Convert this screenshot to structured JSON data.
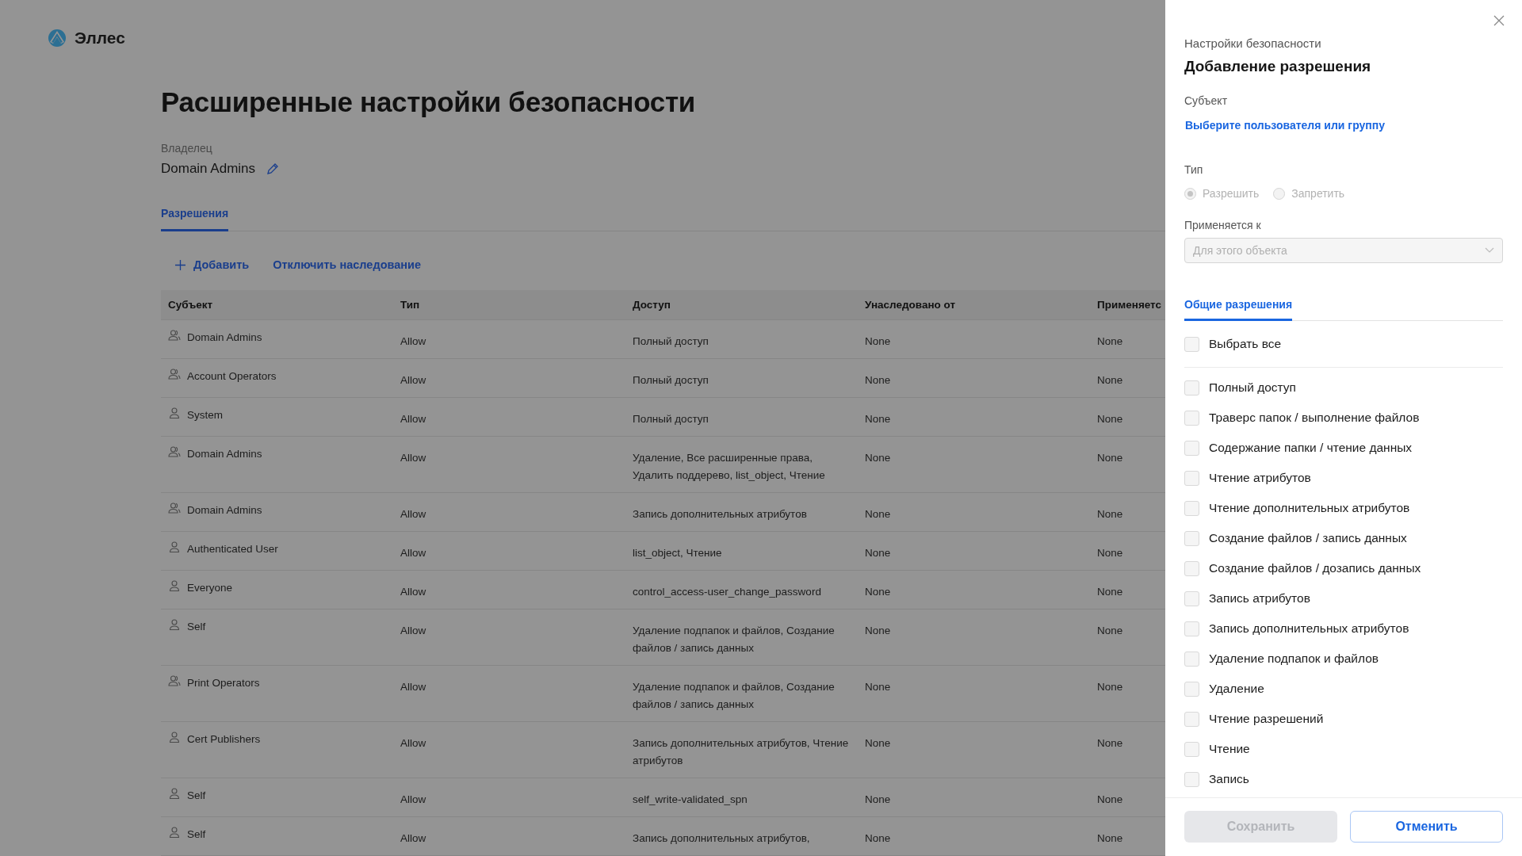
{
  "app": {
    "name": "Эллес"
  },
  "page": {
    "title": "Расширенные настройки безопасности",
    "owner_label": "Владелец",
    "owner": "Domain Admins",
    "tabs": [
      {
        "label": "Разрешения",
        "selected": true
      }
    ],
    "actions": [
      {
        "kind": "add",
        "label": "Добавить"
      },
      {
        "kind": "link",
        "label": "Отключить наследование"
      }
    ]
  },
  "table": {
    "columns": [
      "Субъект",
      "Тип",
      "Доступ",
      "Унаследовано от",
      "Применяетс"
    ],
    "rows": [
      {
        "kind": "group",
        "cells": [
          "Domain Admins",
          "Allow",
          "Полный доступ",
          "None",
          "None"
        ]
      },
      {
        "kind": "group",
        "cells": [
          "Account Operators",
          "Allow",
          "Полный доступ",
          "None",
          "None"
        ]
      },
      {
        "kind": "user",
        "cells": [
          "System",
          "Allow",
          "Полный доступ",
          "None",
          "None"
        ]
      },
      {
        "kind": "group",
        "cells": [
          "Domain Admins",
          "Allow",
          "Удаление, Все расширенные права, Удалить поддерево, list_object, Чтение",
          "None",
          "None"
        ]
      },
      {
        "kind": "group",
        "cells": [
          "Domain Admins",
          "Allow",
          "Запись дополнительных атрибутов",
          "None",
          "None"
        ]
      },
      {
        "kind": "user",
        "cells": [
          "Authenticated User",
          "Allow",
          "list_object, Чтение",
          "None",
          "None"
        ]
      },
      {
        "kind": "user",
        "cells": [
          "Everyone",
          "Allow",
          "control_access-user_change_password",
          "None",
          "None"
        ]
      },
      {
        "kind": "user",
        "cells": [
          "Self",
          "Allow",
          "Удаление подпапок и файлов, Создание файлов / запись данных",
          "None",
          "None"
        ]
      },
      {
        "kind": "group",
        "cells": [
          "Print Operators",
          "Allow",
          "Удаление подпапок и файлов, Создание файлов / запись данных",
          "None",
          "None"
        ]
      },
      {
        "kind": "user",
        "cells": [
          "Cert Publishers",
          "Allow",
          "Запись дополнительных атрибутов, Чтение атрибутов",
          "None",
          "None"
        ]
      },
      {
        "kind": "user",
        "cells": [
          "Self",
          "Allow",
          "self_write-validated_spn",
          "None",
          "None"
        ]
      },
      {
        "kind": "user",
        "cells": [
          "Self",
          "Allow",
          "Запись дополнительных атрибутов,",
          "None",
          "None"
        ]
      }
    ]
  },
  "drawer": {
    "subtitle": "Настройки безопасности",
    "title": "Добавление разрешения",
    "subject_label": "Субъект",
    "subject_link": "Выберите пользователя или группу",
    "type_label": "Тип",
    "type_options": [
      {
        "label": "Разрешить",
        "selected": true,
        "disabled": true
      },
      {
        "label": "Запретить",
        "selected": false,
        "disabled": true
      }
    ],
    "applies_label": "Применяется к",
    "applies_select": {
      "value": "Для этого объекта",
      "disabled": true
    },
    "tabs": [
      {
        "label": "Общие разрешения",
        "selected": true
      }
    ],
    "select_all": {
      "label": "Выбрать все",
      "checked": false
    },
    "permissions": [
      {
        "label": "Полный доступ",
        "checked": false
      },
      {
        "label": "Траверс папок / выполнение файлов",
        "checked": false
      },
      {
        "label": "Содержание папки / чтение данных",
        "checked": false
      },
      {
        "label": "Чтение атрибутов",
        "checked": false
      },
      {
        "label": "Чтение дополнительных атрибутов",
        "checked": false
      },
      {
        "label": "Создание файлов / запись данных",
        "checked": false
      },
      {
        "label": "Создание файлов / дозапись данных",
        "checked": false
      },
      {
        "label": "Запись атрибутов",
        "checked": false
      },
      {
        "label": "Запись дополнительных атрибутов",
        "checked": false
      },
      {
        "label": "Удаление подпапок и файлов",
        "checked": false
      },
      {
        "label": "Удаление",
        "checked": false
      },
      {
        "label": "Чтение разрешений",
        "checked": false
      },
      {
        "label": "Чтение",
        "checked": false
      },
      {
        "label": "Запись",
        "checked": false
      }
    ],
    "buttons": [
      {
        "kind": "primary",
        "label": "Сохранить",
        "disabled": true
      },
      {
        "kind": "secondary",
        "label": "Отменить",
        "disabled": false
      }
    ]
  }
}
